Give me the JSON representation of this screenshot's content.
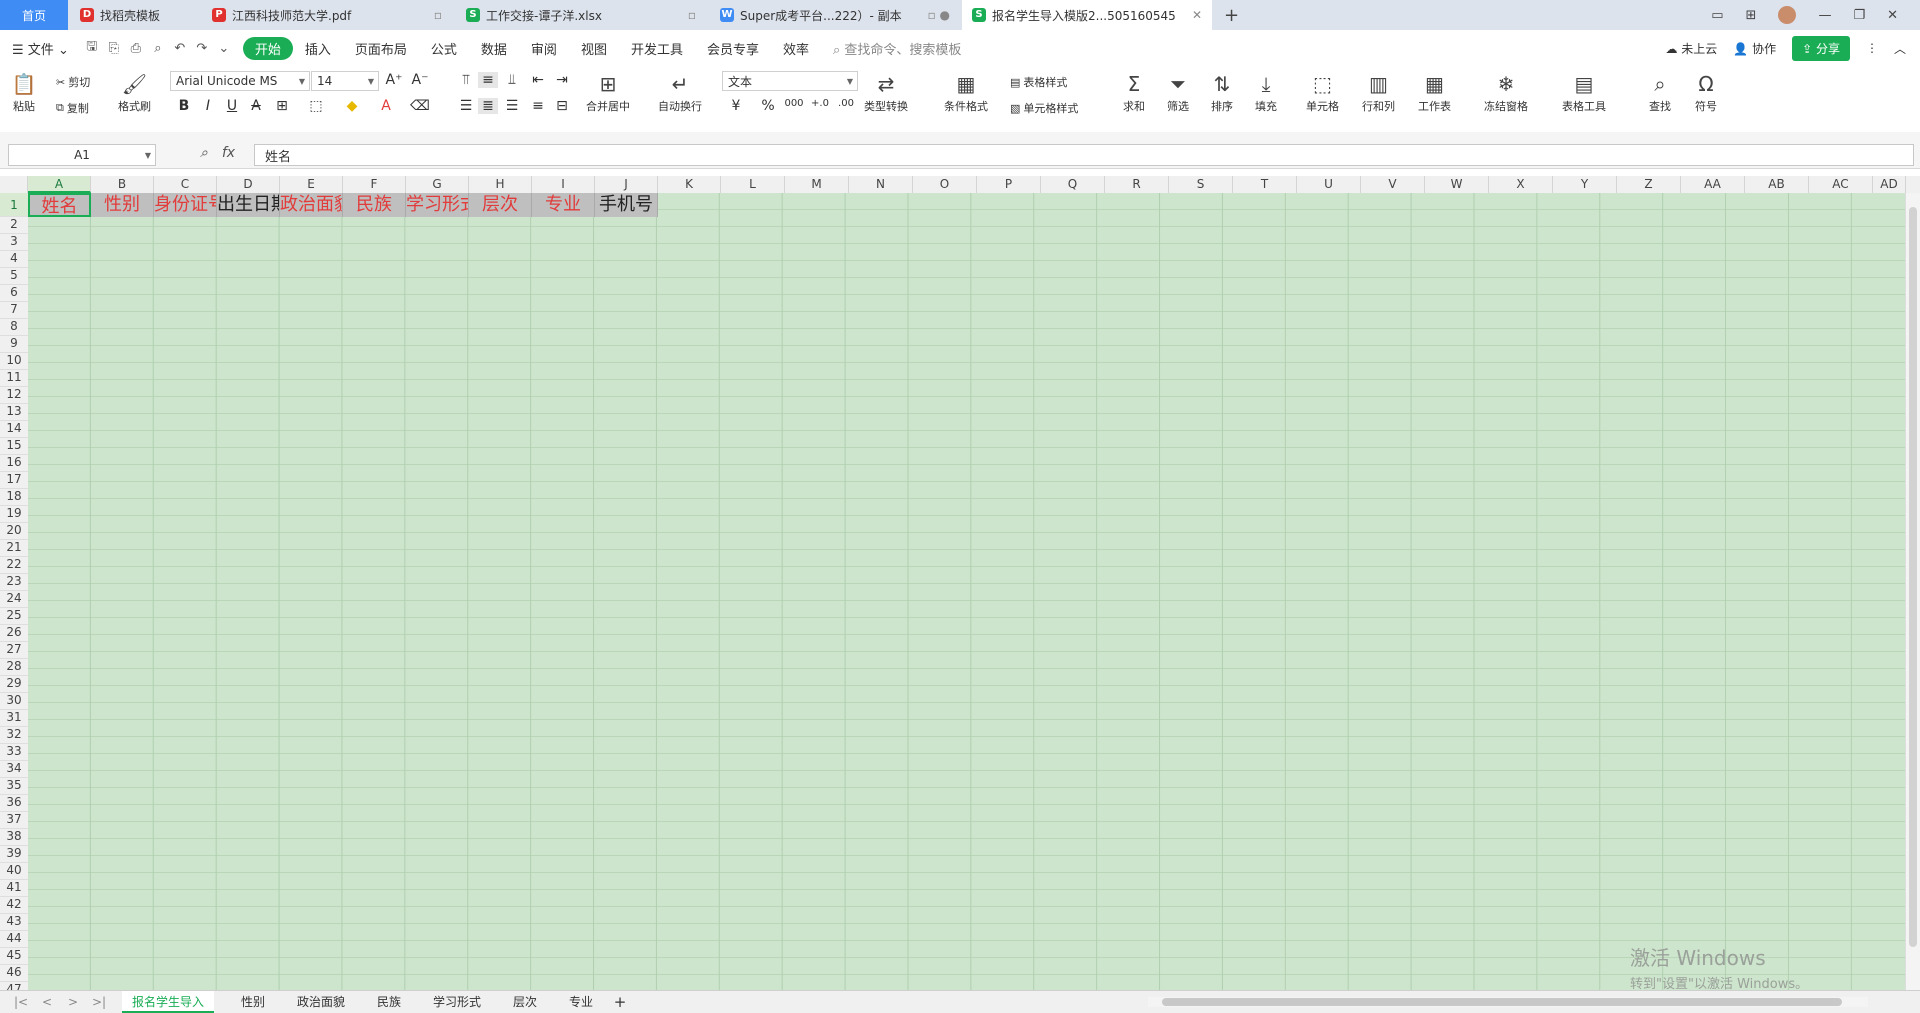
{
  "tabs": [
    {
      "label": "首页",
      "icon": ""
    },
    {
      "label": "找稻壳模板",
      "icon": "docer-icon"
    },
    {
      "label": "江西科技师范大学.pdf",
      "icon": "pdf-icon"
    },
    {
      "label": "工作交接-谭子洋.xlsx",
      "icon": "spreadsheet-icon"
    },
    {
      "label": "Super成考平台...222）- 副本",
      "icon": "word-icon"
    },
    {
      "label": "报名学生导入模版2...505160545",
      "icon": "spreadsheet-icon"
    }
  ],
  "menu": {
    "file": "文件",
    "items": [
      "开始",
      "插入",
      "页面布局",
      "公式",
      "数据",
      "审阅",
      "视图",
      "开发工具",
      "会员专享",
      "效率"
    ],
    "search": "查找命令、搜索模板",
    "cloud": "未上云",
    "collab": "协作",
    "share": "分享"
  },
  "ribbon": {
    "paste": "粘贴",
    "cut": "剪切",
    "copy": "复制",
    "format_painter": "格式刷",
    "font_name": "Arial Unicode MS",
    "font_size": "14",
    "merge": "合并居中",
    "wrap": "自动换行",
    "number_format": "文本",
    "type_convert": "类型转换",
    "cond_format": "条件格式",
    "table_style": "表格样式",
    "cell_style": "单元格样式",
    "sum": "求和",
    "filter": "筛选",
    "sort": "排序",
    "fill": "填充",
    "cell": "单元格",
    "rowcol": "行和列",
    "worksheet": "工作表",
    "freeze": "冻结窗格",
    "table_tools": "表格工具",
    "find": "查找",
    "symbol": "符号"
  },
  "formula_bar": {
    "cell_ref": "A1",
    "fx": "fx",
    "value": "姓名"
  },
  "columns": [
    "A",
    "B",
    "C",
    "D",
    "E",
    "F",
    "G",
    "H",
    "I",
    "J",
    "K",
    "L",
    "M",
    "N",
    "O",
    "P",
    "Q",
    "R",
    "S",
    "T",
    "U",
    "V",
    "W",
    "X",
    "Y",
    "Z",
    "AA",
    "AB",
    "AC",
    "AD"
  ],
  "rows": [
    "1",
    "2",
    "3",
    "4",
    "5",
    "6",
    "7",
    "8",
    "9",
    "10",
    "11",
    "12",
    "13",
    "14",
    "15",
    "16",
    "17",
    "18",
    "19",
    "20",
    "21",
    "22",
    "23",
    "24",
    "25",
    "26",
    "27",
    "28",
    "29",
    "30",
    "31",
    "32",
    "33",
    "34",
    "35",
    "36",
    "37",
    "38",
    "39",
    "40",
    "41",
    "42",
    "43",
    "44",
    "45",
    "46",
    "47"
  ],
  "header_cells": [
    {
      "text": "姓名",
      "color": "red"
    },
    {
      "text": "性别",
      "color": "red"
    },
    {
      "text": "身份证号",
      "color": "red"
    },
    {
      "text": "出生日期",
      "color": "black"
    },
    {
      "text": "政治面貌",
      "color": "red"
    },
    {
      "text": "民族",
      "color": "red"
    },
    {
      "text": "学习形式",
      "color": "red"
    },
    {
      "text": "层次",
      "color": "red"
    },
    {
      "text": "专业",
      "color": "red"
    },
    {
      "text": "手机号",
      "color": "black"
    }
  ],
  "sheets": [
    "报名学生导入",
    "性别",
    "政治面貌",
    "民族",
    "学习形式",
    "层次",
    "专业"
  ],
  "watermark": {
    "line1": "激活 Windows",
    "line2": "转到\"设置\"以激活 Windows。"
  },
  "colors": {
    "accent": "#1aad55",
    "home_tab": "#3f8cf5",
    "grid_bg": "#cde5cc",
    "header_fill": "#bfbfbf",
    "required_text": "#e23b3b"
  }
}
